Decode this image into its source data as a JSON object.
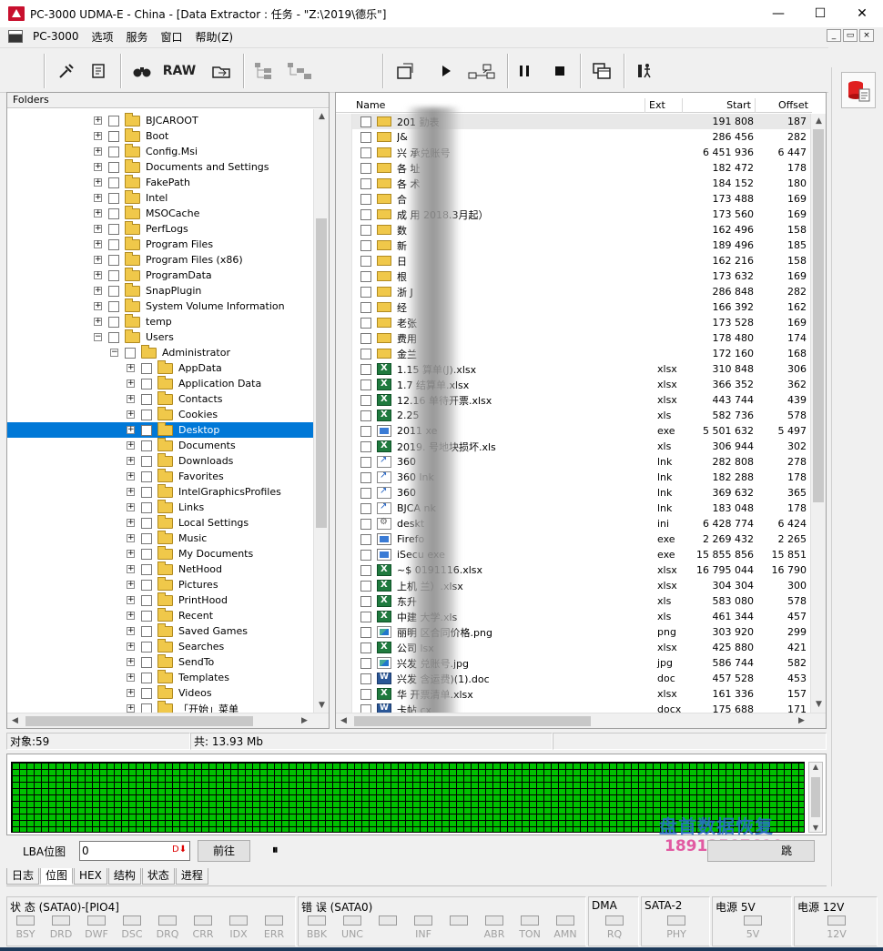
{
  "window": {
    "title": "PC-3000 UDMA-E - China - [Data Extractor : 任务 - \"Z:\\2019\\德乐\"]",
    "minimize": "—",
    "maximize": "☐",
    "close": "✕"
  },
  "menu": {
    "items": [
      "PC-3000",
      "选项",
      "服务",
      "窗口",
      "帮助(Z)"
    ],
    "mdi_min": "_",
    "mdi_restore": "▭",
    "mdi_close": "×"
  },
  "toolbar": {
    "raw_label": "RAW"
  },
  "folders": {
    "header": "Folders",
    "rows": [
      {
        "label": "BJCAROOT",
        "level": 0
      },
      {
        "label": "Boot",
        "level": 0
      },
      {
        "label": "Config.Msi",
        "level": 0
      },
      {
        "label": "Documents and Settings",
        "level": 0
      },
      {
        "label": "FakePath",
        "level": 0
      },
      {
        "label": "Intel",
        "level": 0
      },
      {
        "label": "MSOCache",
        "level": 0
      },
      {
        "label": "PerfLogs",
        "level": 0
      },
      {
        "label": "Program Files",
        "level": 0
      },
      {
        "label": "Program Files (x86)",
        "level": 0
      },
      {
        "label": "ProgramData",
        "level": 0
      },
      {
        "label": "SnapPlugin",
        "level": 0
      },
      {
        "label": "System Volume Information",
        "level": 0
      },
      {
        "label": "temp",
        "level": 0
      },
      {
        "label": "Users",
        "level": 0,
        "expanded": true
      },
      {
        "label": "Administrator",
        "level": 1,
        "expanded": true
      },
      {
        "label": "AppData",
        "level": 2
      },
      {
        "label": "Application Data",
        "level": 2
      },
      {
        "label": "Contacts",
        "level": 2
      },
      {
        "label": "Cookies",
        "level": 2
      },
      {
        "label": "Desktop",
        "level": 2,
        "selected": true
      },
      {
        "label": "Documents",
        "level": 2
      },
      {
        "label": "Downloads",
        "level": 2
      },
      {
        "label": "Favorites",
        "level": 2
      },
      {
        "label": "IntelGraphicsProfiles",
        "level": 2
      },
      {
        "label": "Links",
        "level": 2
      },
      {
        "label": "Local Settings",
        "level": 2
      },
      {
        "label": "Music",
        "level": 2
      },
      {
        "label": "My Documents",
        "level": 2
      },
      {
        "label": "NetHood",
        "level": 2
      },
      {
        "label": "Pictures",
        "level": 2
      },
      {
        "label": "PrintHood",
        "level": 2
      },
      {
        "label": "Recent",
        "level": 2
      },
      {
        "label": "Saved Games",
        "level": 2
      },
      {
        "label": "Searches",
        "level": 2
      },
      {
        "label": "SendTo",
        "level": 2
      },
      {
        "label": "Templates",
        "level": 2
      },
      {
        "label": "Videos",
        "level": 2
      },
      {
        "label": "「开始」菜单",
        "level": 2
      }
    ]
  },
  "files": {
    "columns": {
      "name": "Name",
      "ext": "Ext",
      "start": "Start",
      "offset": "Offset"
    },
    "rows": [
      {
        "icon": "folder",
        "name": "201 勤表",
        "ext": "",
        "start": "191 808",
        "offset": "187"
      },
      {
        "icon": "folder",
        "name": "J&",
        "ext": "",
        "start": "286 456",
        "offset": "282"
      },
      {
        "icon": "folder",
        "name": "兴 承兑账号",
        "ext": "",
        "start": "6 451 936",
        "offset": "6 447"
      },
      {
        "icon": "folder",
        "name": "各 址",
        "ext": "",
        "start": "182 472",
        "offset": "178"
      },
      {
        "icon": "folder",
        "name": "各 术",
        "ext": "",
        "start": "184 152",
        "offset": "180"
      },
      {
        "icon": "folder",
        "name": "合",
        "ext": "",
        "start": "173 488",
        "offset": "169"
      },
      {
        "icon": "folder",
        "name": "成 用 2018.3月起）",
        "ext": "",
        "start": "173 560",
        "offset": "169"
      },
      {
        "icon": "folder",
        "name": "数",
        "ext": "",
        "start": "162 496",
        "offset": "158"
      },
      {
        "icon": "folder",
        "name": "新",
        "ext": "",
        "start": "189 496",
        "offset": "185"
      },
      {
        "icon": "folder",
        "name": "日",
        "ext": "",
        "start": "162 216",
        "offset": "158"
      },
      {
        "icon": "folder",
        "name": "根",
        "ext": "",
        "start": "173 632",
        "offset": "169"
      },
      {
        "icon": "folder",
        "name": "浙 J",
        "ext": "",
        "start": "286 848",
        "offset": "282"
      },
      {
        "icon": "folder",
        "name": "经",
        "ext": "",
        "start": "166 392",
        "offset": "162"
      },
      {
        "icon": "folder",
        "name": "老张",
        "ext": "",
        "start": "173 528",
        "offset": "169"
      },
      {
        "icon": "folder",
        "name": "费用",
        "ext": "",
        "start": "178 480",
        "offset": "174"
      },
      {
        "icon": "folder",
        "name": "金兰",
        "ext": "",
        "start": "172 160",
        "offset": "168"
      },
      {
        "icon": "excel",
        "name": "1.15 算单(J).xlsx",
        "ext": "xlsx",
        "start": "310 848",
        "offset": "306"
      },
      {
        "icon": "excel",
        "name": "1.7 结算单.xlsx",
        "ext": "xlsx",
        "start": "366 352",
        "offset": "362"
      },
      {
        "icon": "excel",
        "name": "12.16 单待开票.xlsx",
        "ext": "xlsx",
        "start": "443 744",
        "offset": "439"
      },
      {
        "icon": "excel",
        "name": "2.25",
        "ext": "xls",
        "start": "582 736",
        "offset": "578"
      },
      {
        "icon": "exe",
        "name": "2011 xe",
        "ext": "exe",
        "start": "5 501 632",
        "offset": "5 497"
      },
      {
        "icon": "excel",
        "name": "2019. 号地块损坏.xls",
        "ext": "xls",
        "start": "306 944",
        "offset": "302"
      },
      {
        "icon": "lnk",
        "name": "360",
        "ext": "lnk",
        "start": "282 808",
        "offset": "278"
      },
      {
        "icon": "lnk",
        "name": "360 lnk",
        "ext": "lnk",
        "start": "182 288",
        "offset": "178"
      },
      {
        "icon": "lnk",
        "name": "360",
        "ext": "lnk",
        "start": "369 632",
        "offset": "365"
      },
      {
        "icon": "lnk",
        "name": "BJCA nk",
        "ext": "lnk",
        "start": "183 048",
        "offset": "178"
      },
      {
        "icon": "ini",
        "name": "deskt",
        "ext": "ini",
        "start": "6 428 774",
        "offset": "6 424"
      },
      {
        "icon": "exe",
        "name": "Firefo",
        "ext": "exe",
        "start": "2 269 432",
        "offset": "2 265"
      },
      {
        "icon": "exe",
        "name": "iSecu exe",
        "ext": "exe",
        "start": "15 855 856",
        "offset": "15 851"
      },
      {
        "icon": "excel",
        "name": "~$ 0191116.xlsx",
        "ext": "xlsx",
        "start": "16 795 044",
        "offset": "16 790"
      },
      {
        "icon": "excel",
        "name": "上机 兰）.xlsx",
        "ext": "xlsx",
        "start": "304 304",
        "offset": "300"
      },
      {
        "icon": "excel",
        "name": "东升",
        "ext": "xls",
        "start": "583 080",
        "offset": "578"
      },
      {
        "icon": "excel",
        "name": "中建 大学.xls",
        "ext": "xls",
        "start": "461 344",
        "offset": "457"
      },
      {
        "icon": "png",
        "name": "丽明 区合同价格.png",
        "ext": "png",
        "start": "303 920",
        "offset": "299"
      },
      {
        "icon": "excel",
        "name": "公司 lsx",
        "ext": "xlsx",
        "start": "425 880",
        "offset": "421"
      },
      {
        "icon": "png",
        "name": "兴发 兑账号.jpg",
        "ext": "jpg",
        "start": "586 744",
        "offset": "582"
      },
      {
        "icon": "word",
        "name": "兴发 含运费)(1).doc",
        "ext": "doc",
        "start": "457 528",
        "offset": "453"
      },
      {
        "icon": "excel",
        "name": "华 开票清单.xlsx",
        "ext": "xlsx",
        "start": "161 336",
        "offset": "157"
      },
      {
        "icon": "word",
        "name": "卡帖 cx",
        "ext": "docx",
        "start": "175 688",
        "offset": "171"
      }
    ]
  },
  "status": {
    "objects": "对象:59",
    "total": "共: 13.93 Mb"
  },
  "lba": {
    "label": "LBA位图",
    "value": "0",
    "goto_label": "前往",
    "pause_label": "⏸",
    "right_btn_label": "跳"
  },
  "watermark": {
    "line1": "盘首数据恢复",
    "line2": "18913587620"
  },
  "tabs": [
    "日志",
    "位图",
    "HEX",
    "结构",
    "状态",
    "进程"
  ],
  "indicators": {
    "status_title": "状 态 (SATA0)-[PIO4]",
    "status_leds": [
      "BSY",
      "DRD",
      "DWF",
      "DSC",
      "DRQ",
      "CRR",
      "IDX",
      "ERR"
    ],
    "error_title": "错 误 (SATA0)",
    "error_leds": [
      "BBK",
      "UNC",
      "",
      "INF",
      "",
      "ABR",
      "TON",
      "AMN"
    ],
    "dma_title": "DMA",
    "dma_leds": [
      "RQ"
    ],
    "sata_title": "SATA-2",
    "sata_leds": [
      "PHY"
    ],
    "p5_title": "电源 5V",
    "p5_leds": [
      "5V"
    ],
    "p12_title": "电源 12V",
    "p12_leds": [
      "12V"
    ]
  }
}
